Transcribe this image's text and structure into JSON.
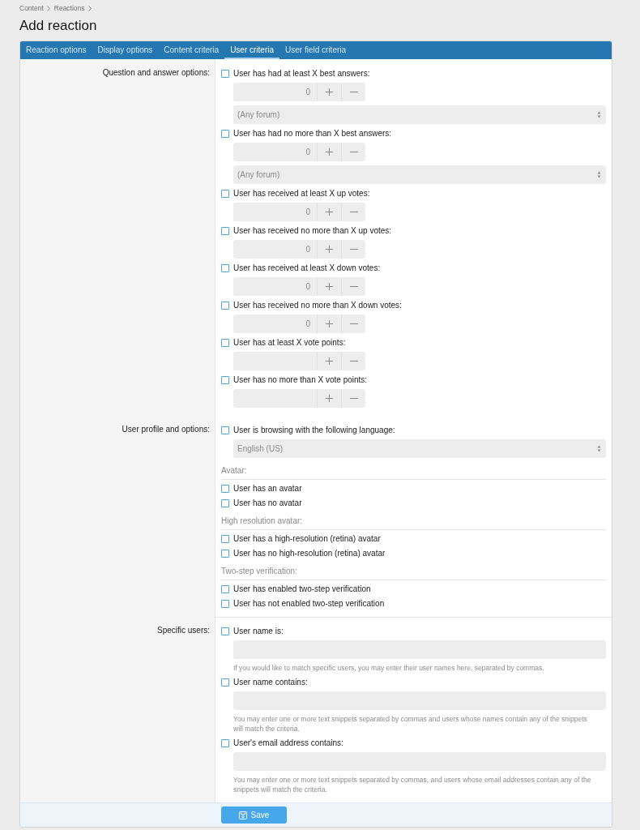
{
  "breadcrumb": [
    {
      "label": "Content"
    },
    {
      "label": "Reactions"
    }
  ],
  "title": "Add reaction",
  "tabs": [
    {
      "label": "Reaction options",
      "selected": false
    },
    {
      "label": "Display options",
      "selected": false
    },
    {
      "label": "Content criteria",
      "selected": false
    },
    {
      "label": "User criteria",
      "selected": true
    },
    {
      "label": "User field criteria",
      "selected": false
    }
  ],
  "sections": [
    {
      "label": "Question and answer options:",
      "divider_above": false,
      "items": [
        {
          "kind": "option",
          "label": "User has had at least X best answers:",
          "checked": false,
          "fields": [
            {
              "kind": "number",
              "value": "0"
            },
            {
              "kind": "select",
              "value": "(Any forum)"
            }
          ]
        },
        {
          "kind": "option",
          "label": "User has had no more than X best answers:",
          "checked": false,
          "fields": [
            {
              "kind": "number",
              "value": "0"
            },
            {
              "kind": "select",
              "value": "(Any forum)"
            }
          ]
        },
        {
          "kind": "option",
          "label": "User has received at least X up votes:",
          "checked": false,
          "fields": [
            {
              "kind": "number",
              "value": "0"
            }
          ]
        },
        {
          "kind": "option",
          "label": "User has received no more than X up votes:",
          "checked": false,
          "fields": [
            {
              "kind": "number",
              "value": "0"
            }
          ]
        },
        {
          "kind": "option",
          "label": "User has received at least X down votes:",
          "checked": false,
          "fields": [
            {
              "kind": "number",
              "value": "0"
            }
          ]
        },
        {
          "kind": "option",
          "label": "User has received no more than X down votes:",
          "checked": false,
          "fields": [
            {
              "kind": "number",
              "value": "0"
            }
          ]
        },
        {
          "kind": "option",
          "label": "User has at least X vote points:",
          "checked": false,
          "fields": [
            {
              "kind": "number"
            }
          ]
        },
        {
          "kind": "option",
          "label": "User has no more than X vote points:",
          "checked": false,
          "fields": [
            {
              "kind": "number"
            }
          ]
        }
      ]
    },
    {
      "label": "User profile and options:",
      "divider_above": false,
      "items": [
        {
          "kind": "option",
          "label": "User is browsing with the following language:",
          "checked": false,
          "fields": [
            {
              "kind": "select",
              "value": "English (US)"
            }
          ]
        },
        {
          "kind": "heading",
          "label": "Avatar:"
        },
        {
          "kind": "option",
          "label": "User has an avatar",
          "checked": false
        },
        {
          "kind": "option",
          "label": "User has no avatar",
          "checked": false
        },
        {
          "kind": "heading",
          "label": "High resolution avatar:"
        },
        {
          "kind": "option",
          "label": "User has a high-resolution (retina) avatar",
          "checked": false
        },
        {
          "kind": "option",
          "label": "User has no high-resolution (retina) avatar",
          "checked": false
        },
        {
          "kind": "heading",
          "label": "Two-step verification:"
        },
        {
          "kind": "option",
          "label": "User has enabled two-step verification",
          "checked": false
        },
        {
          "kind": "option",
          "label": "User has not enabled two-step verification",
          "checked": false
        }
      ]
    },
    {
      "label": "Specific users:",
      "divider_above": true,
      "items": [
        {
          "kind": "option",
          "label": "User name is:",
          "checked": false,
          "fields": [
            {
              "kind": "text"
            }
          ],
          "hint": "If you would like to match specific users, you may enter their user names here, separated by commas."
        },
        {
          "kind": "option",
          "label": "User name contains:",
          "checked": false,
          "fields": [
            {
              "kind": "text"
            }
          ],
          "hint": "You may enter one or more text snippets separated by commas and users whose names contain any of the snippets will match the criteria."
        },
        {
          "kind": "option",
          "label": "User's email address contains:",
          "checked": false,
          "fields": [
            {
              "kind": "text"
            }
          ],
          "hint": "You may enter one or more text snippets separated by commas, and users whose email addresses contain any of the snippets will match the criteria."
        }
      ]
    }
  ],
  "save_button": {
    "label": "Save"
  }
}
